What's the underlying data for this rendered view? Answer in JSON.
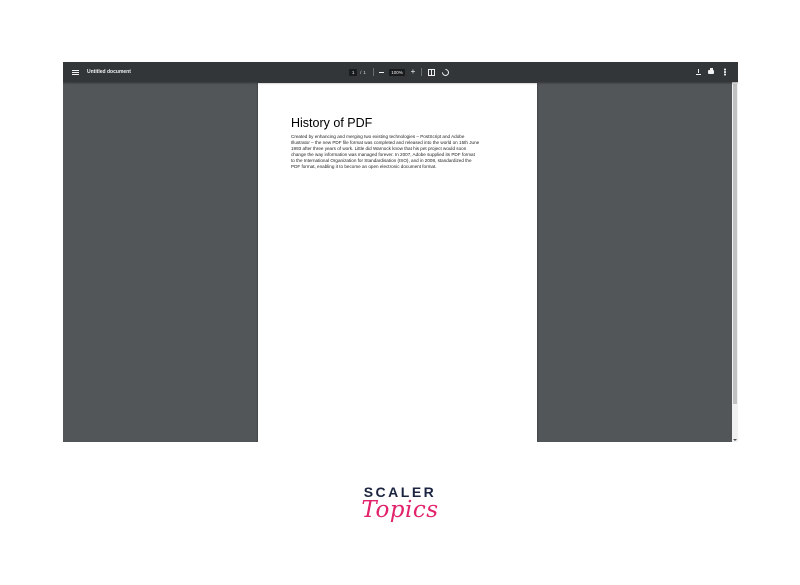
{
  "toolbar": {
    "title": "Untitled document",
    "page_current": "1",
    "page_separator": "/",
    "page_total": "1",
    "zoom_out_icon": "minus-icon",
    "zoom_level": "100%",
    "zoom_in_label": "+",
    "fit_icon": "fit-page-icon",
    "rotate_icon": "rotate-icon",
    "download_icon": "download-icon",
    "print_icon": "print-icon",
    "more_icon": "more-vert-icon",
    "menu_icon": "hamburger-menu-icon"
  },
  "document": {
    "heading": "History of PDF",
    "body_lines": [
      "Created by enhancing and merging two existing technologies – PostScript and Adobe",
      "Illustrator – the new PDF file format was completed and released into the world on 15th June",
      "1993 after three years of work. Little did Warnock know that his pet project would soon",
      "change the way information was managed forever. In 2007, Adobe supplied its PDF format",
      "to the International Organization for Standardisation (ISO), and in 2008, standardized the",
      "PDF format, enabling it to become an open electronic document format."
    ]
  },
  "brand": {
    "name": "SCALER",
    "subname": "Topics"
  },
  "colors": {
    "toolbar_bg": "#323639",
    "viewer_bg": "#525659",
    "page_bg": "#ffffff",
    "brand_navy": "#1b2440",
    "brand_pink": "#e2226b"
  }
}
